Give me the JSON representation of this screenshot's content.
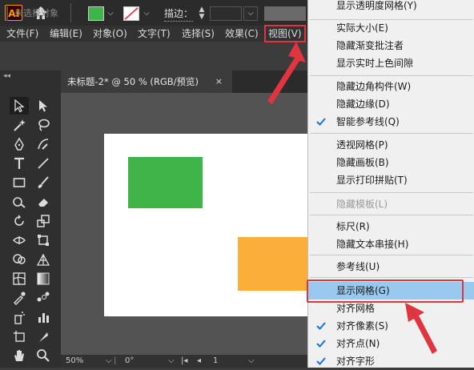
{
  "app": {
    "logo_text": "Ai"
  },
  "menubar": {
    "items": [
      "文件(F)",
      "编辑(E)",
      "对象(O)",
      "文字(T)",
      "选择(S)",
      "效果(C)",
      "视图(V)"
    ]
  },
  "controlbar": {
    "selection_status": "未选择对象",
    "stroke_label": "描边：",
    "fill_color": "#3fb549"
  },
  "document": {
    "tab_title": "未标题-2* @ 50 % (RGB/预览)",
    "close_glyph": "×"
  },
  "artwork": {
    "green_color": "#3fb549",
    "orange_color": "#fbaf3a"
  },
  "statusbar": {
    "zoom": "50%",
    "rotation": "0°",
    "artboard_number": "1"
  },
  "view_menu": {
    "items": [
      {
        "label": "显示透明度网格(Y)",
        "checked": false,
        "disabled": false
      },
      {
        "label": "实际大小(E)",
        "checked": false,
        "disabled": false
      },
      {
        "label": "隐藏渐变批注者",
        "checked": false,
        "disabled": false
      },
      {
        "label": "显示实时上色间隙",
        "checked": false,
        "disabled": false
      },
      {
        "label": "隐藏边角构件(W)",
        "checked": false,
        "disabled": false
      },
      {
        "label": "隐藏边缘(D)",
        "checked": false,
        "disabled": false
      },
      {
        "label": "智能参考线(Q)",
        "checked": true,
        "disabled": false
      },
      {
        "label": "透视网格(P)",
        "checked": false,
        "disabled": false
      },
      {
        "label": "隐藏画板(B)",
        "checked": false,
        "disabled": false
      },
      {
        "label": "显示打印拼贴(T)",
        "checked": false,
        "disabled": false
      },
      {
        "label": "隐藏模板(L)",
        "checked": false,
        "disabled": true
      },
      {
        "label": "标尺(R)",
        "checked": false,
        "disabled": false
      },
      {
        "label": "隐藏文本串接(H)",
        "checked": false,
        "disabled": false
      },
      {
        "label": "参考线(U)",
        "checked": false,
        "disabled": false
      },
      {
        "label": "显示网格(G)",
        "checked": false,
        "disabled": false,
        "highlighted": true
      },
      {
        "label": "对齐网格",
        "checked": false,
        "disabled": false
      },
      {
        "label": "对齐像素(S)",
        "checked": true,
        "disabled": false
      },
      {
        "label": "对齐点(N)",
        "checked": true,
        "disabled": false
      },
      {
        "label": "对齐字形",
        "checked": true,
        "disabled": false
      }
    ]
  },
  "colors": {
    "menu_highlight": "#99c9ef",
    "annotation_red": "#e0343f",
    "check_blue": "#1473e6"
  }
}
